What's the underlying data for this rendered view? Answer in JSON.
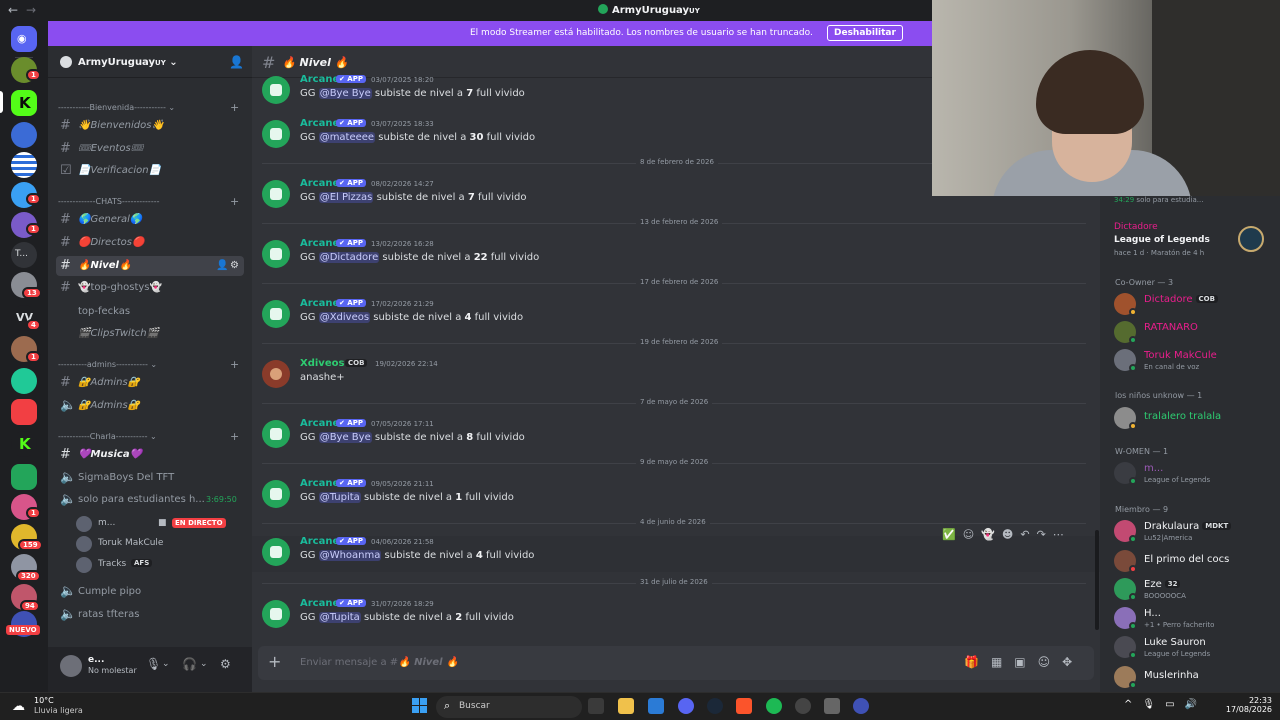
{
  "window": {
    "title": "ArmyUruguay",
    "title_suffix": "UY"
  },
  "banner": {
    "text": "El modo Streamer está habilitado. Los nombres de usuario se han truncado.",
    "button": "Deshabilitar"
  },
  "rail": {
    "badges": [
      "1",
      "1",
      "1",
      "13",
      "4",
      "1",
      "1",
      "1",
      "159",
      "320",
      "94"
    ],
    "labels": [
      "T...",
      "VV"
    ],
    "new_label": "NUEVO"
  },
  "guild": {
    "name": "ArmyUruguay",
    "name_suffix": "UY",
    "name_chevron": "⌄"
  },
  "sidebar": {
    "categories": [
      "-----------Bienvenida-----------",
      "-------------CHATS-------------",
      "----------admins-----------",
      "-----------Charla-----------"
    ],
    "channels": [
      "👋Bienvenidos👋",
      "🎟Eventos🎟",
      "📄Verificacion📄",
      "🌎General🌎",
      "🔴Directos🔴",
      "🔥Nivel🔥",
      "👻top-ghostys👻",
      "top-feckas",
      "🎬ClipsTwitch🎬",
      "🔐Admins🔐",
      "🔐Admins🔐",
      "💜Musica💜",
      "SigmaBoys Del TFT",
      "solo para estudiantes h...",
      "Cumple pipo",
      "ratas tfteras"
    ],
    "voice_timer": "3:69:50",
    "voice_users": [
      "m...",
      "Toruk MakCule",
      "Tracks"
    ],
    "live_label": "EN DIRECTO",
    "tracks_tag": "AFS"
  },
  "user_panel": {
    "name": "e...",
    "status": "No molestar"
  },
  "chat": {
    "channel_name": "🔥 Nivel 🔥",
    "app_tag": "✔ APP",
    "messages": [
      {
        "author": "Arcane",
        "ts": "03/07/2025 18:20",
        "pre": "GG ",
        "mention": "@Bye Bye",
        "mid": " subiste de nivel a ",
        "level": "7",
        "post": " full vivido"
      },
      {
        "author": "Arcane",
        "ts": "03/07/2025 18:33",
        "pre": "GG ",
        "mention": "@mateeee",
        "mid": " subiste de nivel a ",
        "level": "30",
        "post": " full vivido"
      },
      {
        "author": "Arcane",
        "ts": "08/02/2026 14:27",
        "pre": "GG ",
        "mention": "@El Pizzas",
        "mid": " subiste de nivel a ",
        "level": "7",
        "post": " full vivido"
      },
      {
        "author": "Arcane",
        "ts": "13/02/2026 16:28",
        "pre": "GG ",
        "mention": "@Dictadore",
        "mid": " subiste de nivel a ",
        "level": "22",
        "post": " full vivido"
      },
      {
        "author": "Arcane",
        "ts": "17/02/2026 21:29",
        "pre": "GG ",
        "mention": "@Xdiveos",
        "mid": " subiste de nivel a ",
        "level": "4",
        "post": " full vivido"
      },
      {
        "author": "Xdiveos",
        "ts": "19/02/2026 22:14",
        "tag": "COB",
        "text": "anashe+"
      },
      {
        "author": "Arcane",
        "ts": "07/05/2026 17:11",
        "pre": "GG ",
        "mention": "@Bye Bye",
        "mid": " subiste de nivel a ",
        "level": "8",
        "post": " full vivido"
      },
      {
        "author": "Arcane",
        "ts": "09/05/2026 21:11",
        "pre": "GG ",
        "mention": "@Tupita",
        "mid": " subiste de nivel a ",
        "level": "1",
        "post": " full vivido"
      },
      {
        "author": "Arcane",
        "ts": "04/06/2026 21:58",
        "pre": "GG ",
        "mention": "@Whoanma",
        "mid": " subiste de nivel a ",
        "level": "4",
        "post": " full vivido"
      },
      {
        "author": "Arcane",
        "ts": "31/07/2026 18:29",
        "pre": "GG ",
        "mention": "@Tupita",
        "mid": " subiste de nivel a ",
        "level": "2",
        "post": " full vivido"
      }
    ],
    "dividers": [
      "8 de febrero de 2026",
      "13 de febrero de 2026",
      "17 de febrero de 2026",
      "19 de febrero de 2026",
      "7 de mayo de 2026",
      "9 de mayo de 2026",
      "4 de junio de 2026",
      "31 de julio de 2026"
    ],
    "composer_placeholder": "Enviar mensaje a #",
    "composer_channel": "🔥 Nivel 🔥"
  },
  "members": {
    "activity": {
      "time": "34:29",
      "text": "solo para estudia..."
    },
    "now_playing": {
      "user": "Dictadore",
      "game": "League of Legends",
      "meta1": "hace 1 d",
      "meta2": "Maratón de 4 h"
    },
    "groups": [
      {
        "title": "Co-Owner — 3",
        "members": [
          {
            "name": "Dictadore",
            "tag": "COB",
            "sub": "",
            "color": "#e91e8c"
          },
          {
            "name": "RATANARO",
            "tag": "",
            "sub": "",
            "color": "#e91e8c"
          },
          {
            "name": "Toruk MakCule",
            "tag": "",
            "sub": "En canal de voz",
            "color": "#e91e8c"
          }
        ]
      },
      {
        "title": "los niños unknow — 1",
        "members": [
          {
            "name": "tralalero tralala",
            "tag": "",
            "sub": "",
            "color": "#2ecc71"
          }
        ]
      },
      {
        "title": "W-OMEN — 1",
        "members": [
          {
            "name": "m...",
            "tag": "",
            "sub": "League of Legends",
            "color": "#9b59b6"
          }
        ]
      },
      {
        "title": "Miembro — 9",
        "members": [
          {
            "name": "Drakulaura",
            "tag": "MDKT",
            "sub": "Lu52|America",
            "color": "#f2f3f5"
          },
          {
            "name": "El primo del cocs",
            "tag": "",
            "sub": "",
            "color": "#f2f3f5"
          },
          {
            "name": "Eze",
            "tag": "32",
            "sub": "BOOOOOCA",
            "color": "#f2f3f5"
          },
          {
            "name": "H...",
            "tag": "",
            "sub": "+1 • Perro facherito",
            "color": "#f2f3f5"
          },
          {
            "name": "Luke Sauron",
            "tag": "",
            "sub": "League of Legends",
            "color": "#f2f3f5"
          },
          {
            "name": "Muslerinha",
            "tag": "",
            "sub": "",
            "color": "#f2f3f5"
          }
        ]
      }
    ]
  },
  "taskbar": {
    "weather_temp": "10°C",
    "weather_desc": "Lluvia ligera",
    "search": "Buscar",
    "time": "22:33",
    "date": "17/08/2026"
  }
}
